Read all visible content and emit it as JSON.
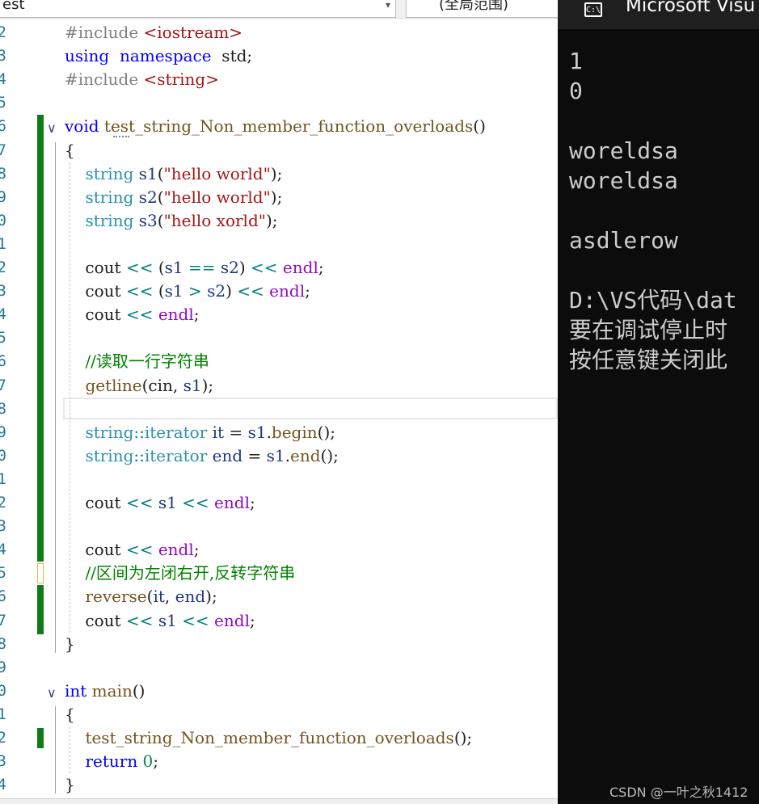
{
  "toolbar": {
    "scope_left": "est",
    "scope_right": "(全局范围)"
  },
  "editor": {
    "line_numbers": [
      "2",
      "3",
      "4",
      "5",
      "6",
      "7",
      "8",
      "9",
      "0",
      "1",
      "2",
      "3",
      "4",
      "5",
      "6",
      "7",
      "8",
      "9",
      "0",
      "1",
      "2",
      "3",
      "4",
      "5",
      "6",
      "7",
      "8",
      "9",
      "0",
      "1",
      "2",
      "3",
      "4"
    ],
    "lines": [
      [
        [
          "pp",
          "#include "
        ],
        [
          "inc",
          "<iostream>"
        ]
      ],
      [
        [
          "kw",
          "using"
        ],
        [
          "",
          "  "
        ],
        [
          "kw",
          "namespace"
        ],
        [
          "",
          "  std;"
        ]
      ],
      [
        [
          "pp",
          "#include "
        ],
        [
          "inc",
          "<string>"
        ]
      ],
      [],
      [
        [
          "kw",
          "void"
        ],
        [
          "",
          ""
        ],
        [
          "fn",
          " test_string_Non_member_function_overloads"
        ],
        [
          "",
          "()"
        ]
      ],
      [
        [
          "",
          "{"
        ]
      ],
      [
        [
          "",
          "    "
        ],
        [
          "ty",
          "string"
        ],
        [
          "",
          ""
        ],
        [
          "vr",
          " s1"
        ],
        [
          "",
          "("
        ],
        [
          "str",
          "\"hello world\""
        ],
        [
          "",
          ");"
        ]
      ],
      [
        [
          "",
          "    "
        ],
        [
          "ty",
          "string"
        ],
        [
          "vr",
          " s2"
        ],
        [
          "",
          "("
        ],
        [
          "str",
          "\"hello world\""
        ],
        [
          "",
          ");"
        ]
      ],
      [
        [
          "",
          "    "
        ],
        [
          "ty",
          "string"
        ],
        [
          "vr",
          " s3"
        ],
        [
          "",
          "("
        ],
        [
          "str",
          "\"hello xorld\""
        ],
        [
          "",
          ");"
        ]
      ],
      [],
      [
        [
          "",
          "    cout "
        ],
        [
          "op",
          "<<"
        ],
        [
          "",
          " ("
        ],
        [
          "vr",
          "s1"
        ],
        [
          "op",
          " == "
        ],
        [
          "vr",
          "s2"
        ],
        [
          "",
          ") "
        ],
        [
          "op",
          "<<"
        ],
        [
          "mc",
          " endl"
        ],
        [
          "",
          ";"
        ]
      ],
      [
        [
          "",
          "    cout "
        ],
        [
          "op",
          "<<"
        ],
        [
          "",
          " ("
        ],
        [
          "vr",
          "s1"
        ],
        [
          "op",
          " > "
        ],
        [
          "vr",
          "s2"
        ],
        [
          "",
          ") "
        ],
        [
          "op",
          "<<"
        ],
        [
          "mc",
          " endl"
        ],
        [
          "",
          ";"
        ]
      ],
      [
        [
          "",
          "    cout "
        ],
        [
          "op",
          "<<"
        ],
        [
          "mc",
          " endl"
        ],
        [
          "",
          ";"
        ]
      ],
      [],
      [
        [
          "",
          "    "
        ],
        [
          "cm",
          "//读取一行字符串"
        ]
      ],
      [
        [
          "",
          "    "
        ],
        [
          "fn",
          "getline"
        ],
        [
          "",
          "(cin, "
        ],
        [
          "vr",
          "s1"
        ],
        [
          "",
          ");"
        ]
      ],
      [],
      [
        [
          "",
          "    "
        ],
        [
          "ty",
          "string"
        ],
        [
          "op",
          "::"
        ],
        [
          "ty",
          "iterator"
        ],
        [
          "vr",
          " it"
        ],
        [
          "",
          " = "
        ],
        [
          "vr",
          "s1"
        ],
        [
          "",
          "."
        ],
        [
          "mem",
          "begin"
        ],
        [
          "",
          "();"
        ]
      ],
      [
        [
          "",
          "    "
        ],
        [
          "ty",
          "string"
        ],
        [
          "op",
          "::"
        ],
        [
          "ty",
          "iterator"
        ],
        [
          "vr",
          " end"
        ],
        [
          "",
          " = "
        ],
        [
          "vr",
          "s1"
        ],
        [
          "",
          "."
        ],
        [
          "mem",
          "end"
        ],
        [
          "",
          "();"
        ]
      ],
      [],
      [
        [
          "",
          "    cout "
        ],
        [
          "op",
          "<<"
        ],
        [
          "vr",
          " s1 "
        ],
        [
          "op",
          "<<"
        ],
        [
          "mc",
          " endl"
        ],
        [
          "",
          ";"
        ]
      ],
      [],
      [
        [
          "",
          "    cout "
        ],
        [
          "op",
          "<<"
        ],
        [
          "mc",
          " endl"
        ],
        [
          "",
          ";"
        ]
      ],
      [
        [
          "",
          "    "
        ],
        [
          "cm",
          "//区间为左闭右开,反转字符串"
        ]
      ],
      [
        [
          "",
          "    "
        ],
        [
          "fn",
          "reverse"
        ],
        [
          "",
          "("
        ],
        [
          "vr",
          "it"
        ],
        [
          "",
          ", "
        ],
        [
          "vr",
          "end"
        ],
        [
          "",
          ");"
        ]
      ],
      [
        [
          "",
          "    cout "
        ],
        [
          "op",
          "<<"
        ],
        [
          "vr",
          " s1 "
        ],
        [
          "op",
          "<<"
        ],
        [
          "mc",
          " endl"
        ],
        [
          "",
          ";"
        ]
      ],
      [
        [
          "",
          "}"
        ]
      ],
      [],
      [
        [
          "kw",
          "int"
        ],
        [
          "fn",
          " main"
        ],
        [
          "",
          "()"
        ]
      ],
      [
        [
          "",
          "{"
        ]
      ],
      [
        [
          "",
          "    "
        ],
        [
          "fn",
          "test_string_Non_member_function_overloads"
        ],
        [
          "",
          "();"
        ]
      ],
      [
        [
          "",
          "    "
        ],
        [
          "kw",
          "return"
        ],
        [
          "num",
          " 0"
        ],
        [
          "",
          ";"
        ]
      ],
      [
        [
          "",
          "}"
        ]
      ]
    ]
  },
  "console": {
    "title": "Microsoft Visu",
    "icon": "C:\\",
    "lines": [
      "1",
      "0",
      "",
      "woreldsa",
      "woreldsa",
      "",
      "asdlerow",
      "",
      "D:\\VS代码\\dat",
      "要在调试停止时",
      "按任意键关闭此"
    ]
  },
  "watermark": "CSDN @一叶之秋1412"
}
